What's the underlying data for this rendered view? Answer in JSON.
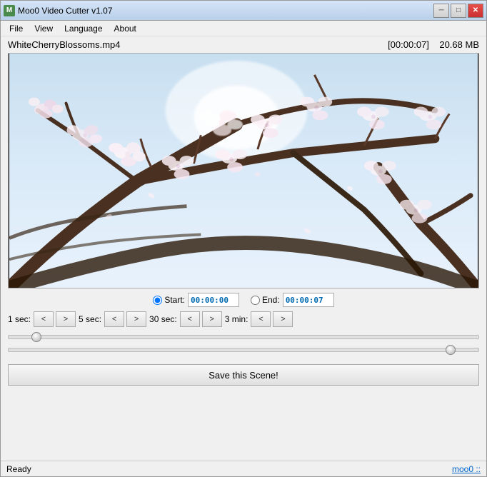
{
  "window": {
    "title": "Moo0 Video Cutter v1.07",
    "icon_label": "M"
  },
  "title_buttons": {
    "minimize": "─",
    "maximize": "□",
    "close": "✕"
  },
  "menu": {
    "items": [
      "File",
      "View",
      "Language",
      "About"
    ]
  },
  "info": {
    "filename": "WhiteCherryBlossoms.mp4",
    "timecode": "[00:00:07]",
    "filesize": "20.68 MB"
  },
  "controls": {
    "start_label": "Start:",
    "end_label": "End:",
    "start_value": "00:00:00",
    "end_value": "00:00:07",
    "seek_groups": [
      {
        "label": "1 sec:",
        "back": "<",
        "fwd": ">"
      },
      {
        "label": "5 sec:",
        "back": "<",
        "fwd": ">"
      },
      {
        "label": "30 sec:",
        "back": "<",
        "fwd": ">"
      },
      {
        "label": "3 min:",
        "back": "<",
        "fwd": ">"
      }
    ],
    "slider1_value": 5,
    "slider2_value": 95
  },
  "save_button": {
    "label": "Save this Scene!"
  },
  "status": {
    "text": "Ready",
    "link": "moo0 ::"
  }
}
